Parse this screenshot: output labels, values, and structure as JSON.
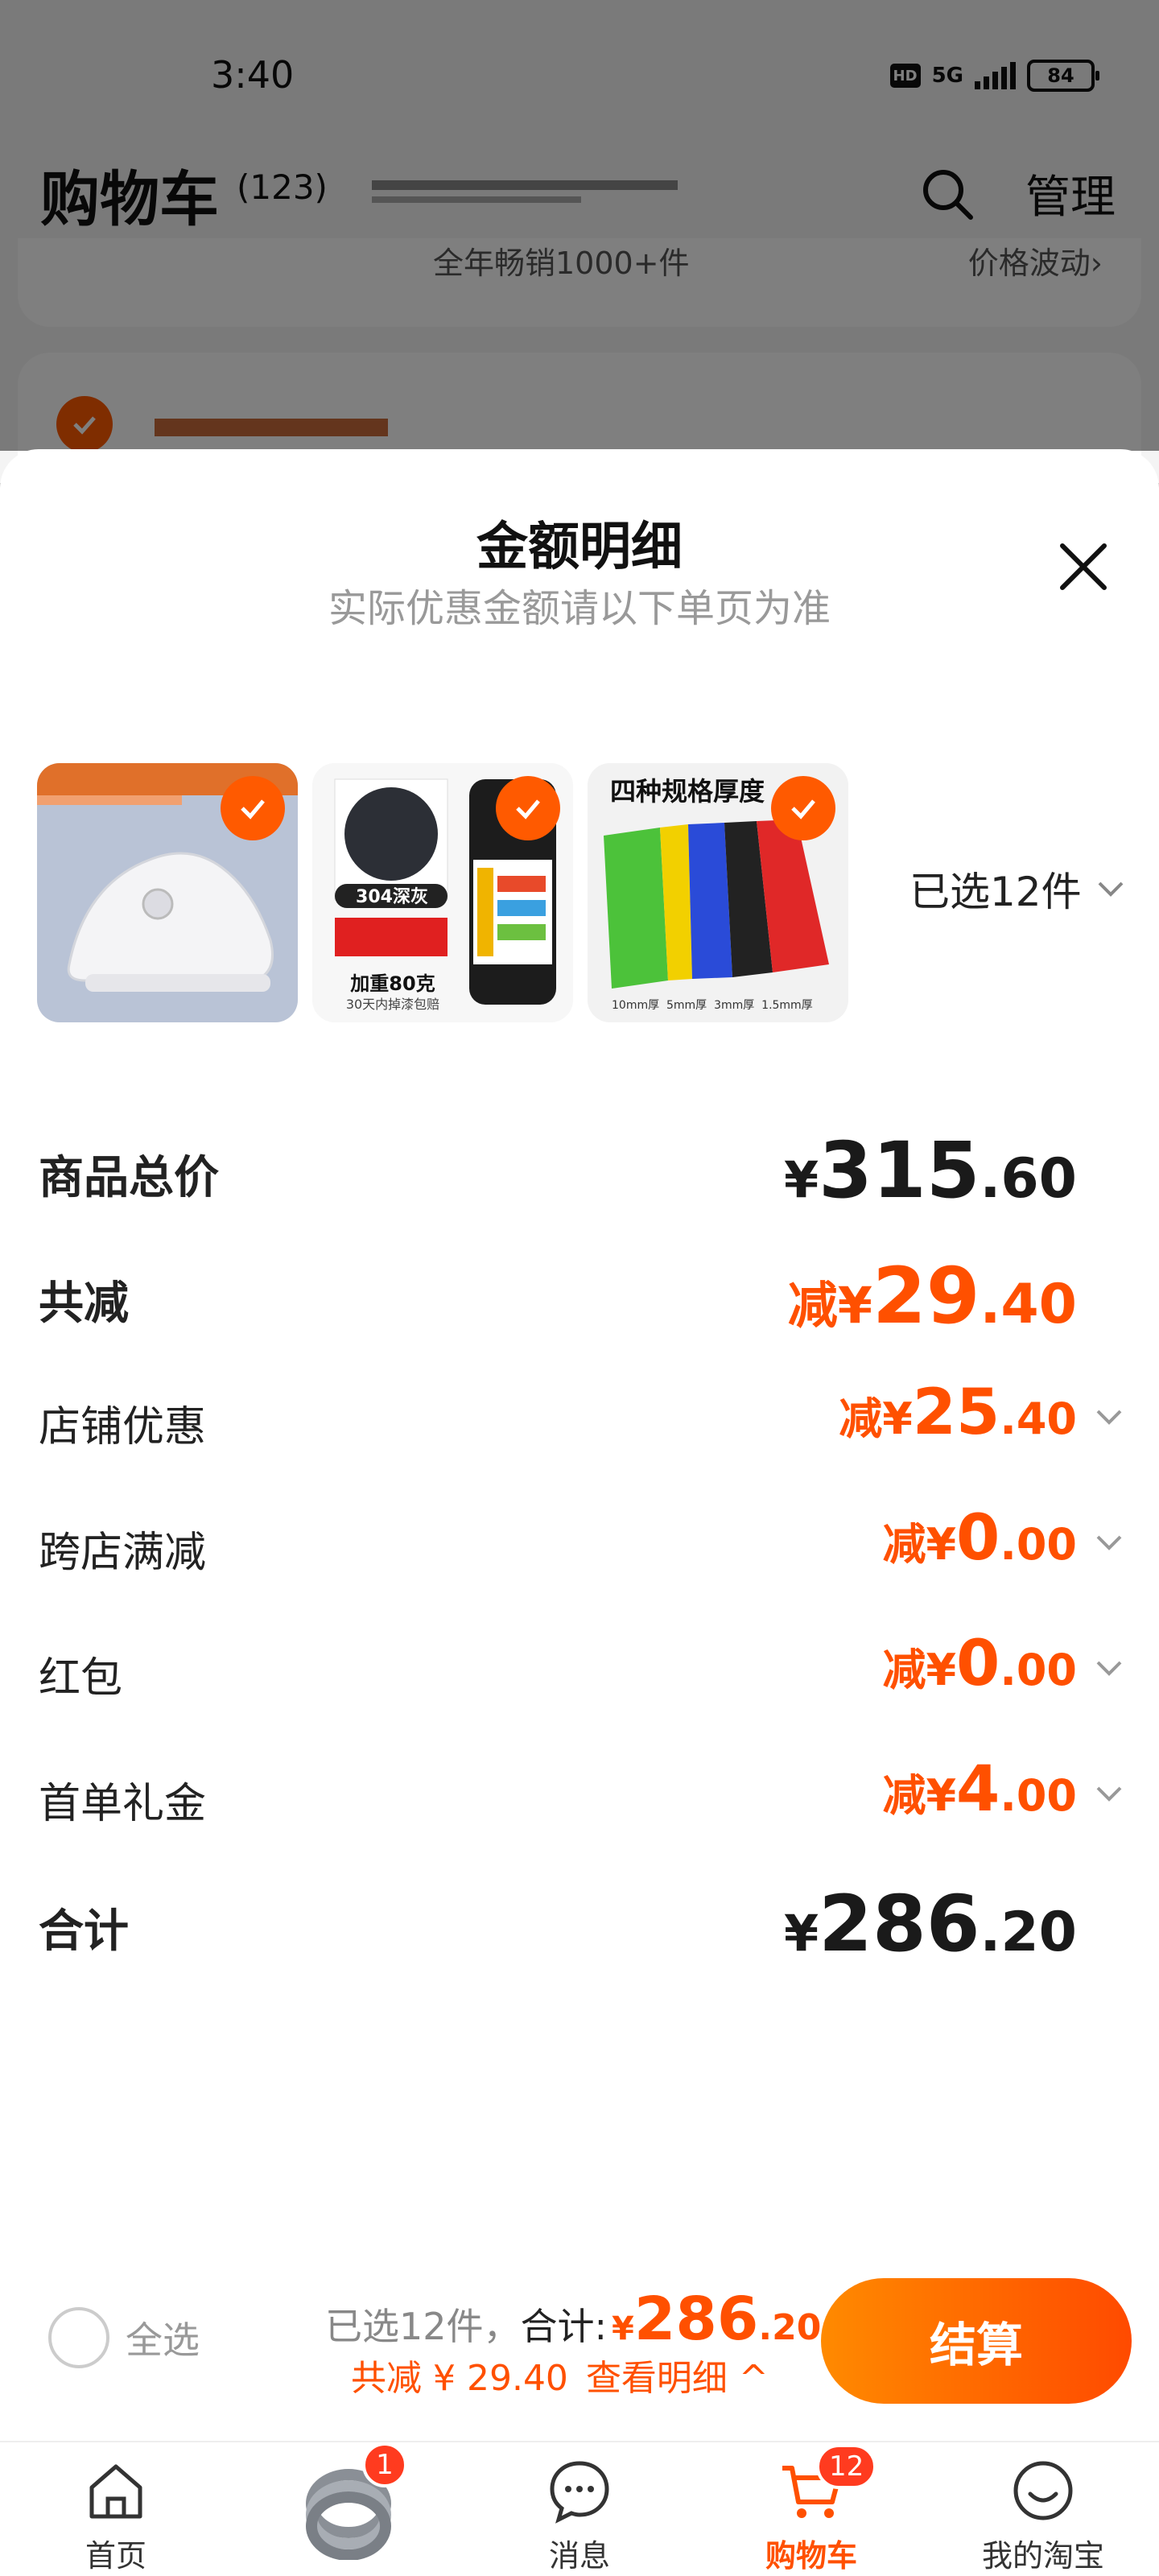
{
  "status_bar": {
    "time": "3:40",
    "network": "5G",
    "battery": "84",
    "hd": "HD"
  },
  "cart_header": {
    "title": "购物车",
    "count": "(123)",
    "manage": "管理",
    "promo_center": "全年畅销1000+件",
    "promo_right": "价格波动›"
  },
  "sheet": {
    "title": "金额明细",
    "subtitle": "实际优惠金额请以下单页为准",
    "selected_label": "已选12件",
    "thumbnails": [
      {
        "name": "white-sneaker"
      },
      {
        "name": "spray-paint",
        "caption1": "304深灰",
        "caption2": "加重80克",
        "caption3": "30天内掉漆包赔"
      },
      {
        "name": "colored-sheets",
        "caption1": "四种规格厚度",
        "caption2": "10mm厚  5mm厚  3mm厚  1.5mm厚"
      }
    ],
    "rows": [
      {
        "label": "商品总价",
        "prefix": "",
        "symbol": "¥",
        "int": "315",
        "dec": ".60"
      },
      {
        "label": "共减",
        "prefix": "减",
        "symbol": "¥",
        "int": "29",
        "dec": ".40"
      },
      {
        "label": "店铺优惠",
        "prefix": "减",
        "symbol": "¥",
        "int": "25",
        "dec": ".40"
      },
      {
        "label": "跨店满减",
        "prefix": "减",
        "symbol": "¥",
        "int": "0",
        "dec": ".00"
      },
      {
        "label": "红包",
        "prefix": "减",
        "symbol": "¥",
        "int": "0",
        "dec": ".00"
      },
      {
        "label": "首单礼金",
        "prefix": "减",
        "symbol": "¥",
        "int": "4",
        "dec": ".00"
      },
      {
        "label": "合计",
        "prefix": "",
        "symbol": "¥",
        "int": "286",
        "dec": ".20"
      }
    ]
  },
  "checkout": {
    "select_all": "全选",
    "selected_text": "已选12件，",
    "total_label": "合计:",
    "total_symbol": "¥",
    "total_int": "286",
    "total_dec": ".20",
    "discount_text": "共减 ¥ 29.40",
    "detail_link": "查看明细 ^",
    "button": "结算"
  },
  "tabbar": {
    "items": [
      {
        "label": "首页",
        "badge": ""
      },
      {
        "label": "",
        "badge": "1"
      },
      {
        "label": "消息",
        "badge": ""
      },
      {
        "label": "购物车",
        "badge": "12"
      },
      {
        "label": "我的淘宝",
        "badge": ""
      }
    ]
  },
  "colors": {
    "accent": "#ff5000",
    "button_start": "#ff8a00",
    "button_end": "#ff4a00"
  }
}
